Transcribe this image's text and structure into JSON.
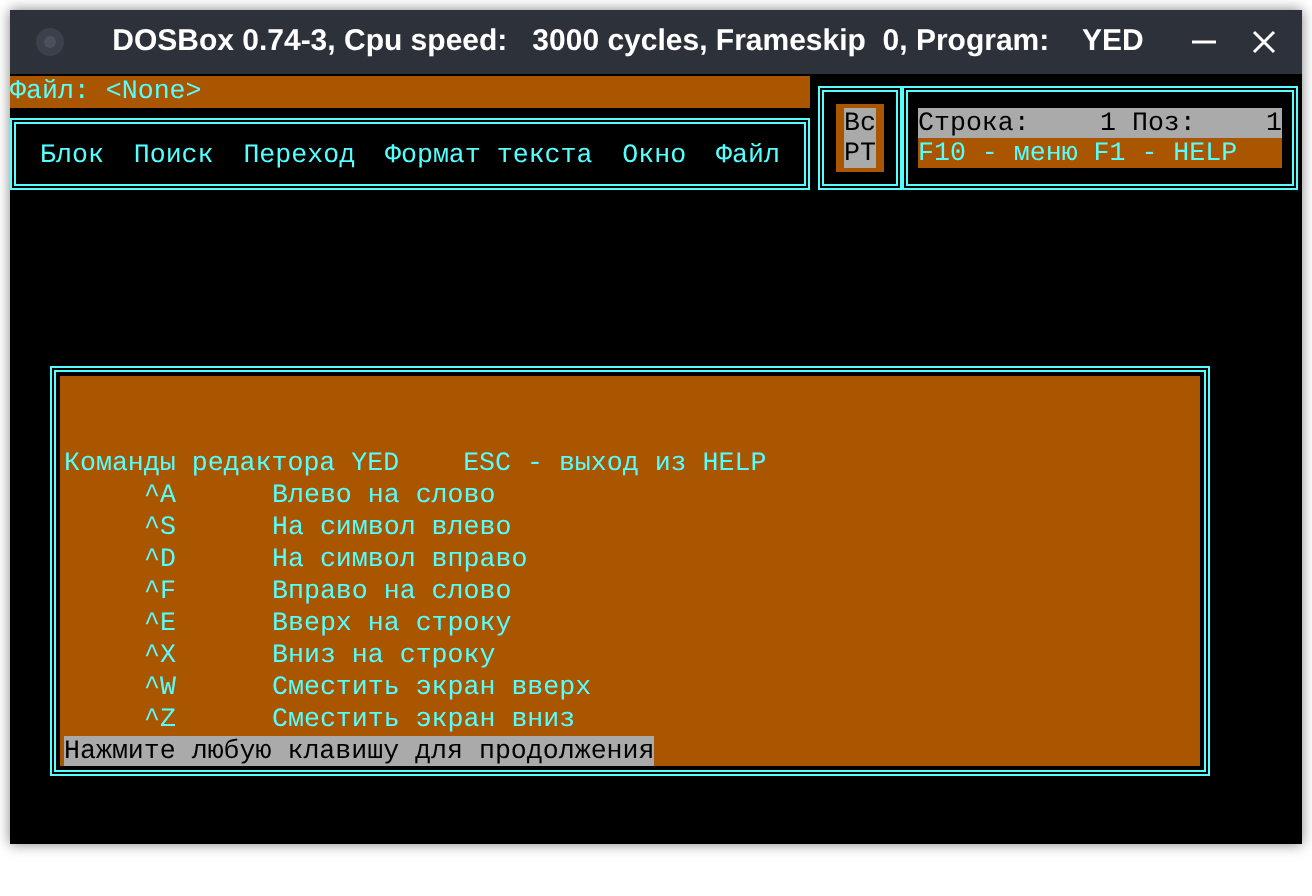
{
  "window": {
    "title": "DOSBox 0.74-3, Cpu speed:   3000 cycles, Frameskip  0, Program:    YED"
  },
  "file_bar": {
    "label": "Файл: <None>"
  },
  "menu": [
    {
      "label": "Блок"
    },
    {
      "label": "Поиск"
    },
    {
      "label": "Переход"
    },
    {
      "label": "Формат текста"
    },
    {
      "label": "Окно"
    },
    {
      "label": "Файл"
    }
  ],
  "mode_box": [
    "Вс",
    "РТ"
  ],
  "status": {
    "line_label": "Строка:",
    "line_value": "1",
    "pos_label": "Поз:",
    "pos_value": "1",
    "hint": "F10 - меню F1 - HELP"
  },
  "help": {
    "title": "Команды редактора YED",
    "escape_hint": "ESC - выход из HELP",
    "commands": [
      {
        "key": "^A",
        "description": "Влево на слово"
      },
      {
        "key": "^S",
        "description": "На символ влево"
      },
      {
        "key": "^D",
        "description": "На символ вправо"
      },
      {
        "key": "^F",
        "description": "Вправо на слово"
      },
      {
        "key": "^E",
        "description": "Вверх на строку"
      },
      {
        "key": "^X",
        "description": "Вниз на строку"
      },
      {
        "key": "^W",
        "description": "Сместить экран вверх"
      },
      {
        "key": "^Z",
        "description": "Сместить экран вниз"
      }
    ],
    "prompt": "Нажмите любую клавишу для продолжения"
  }
}
